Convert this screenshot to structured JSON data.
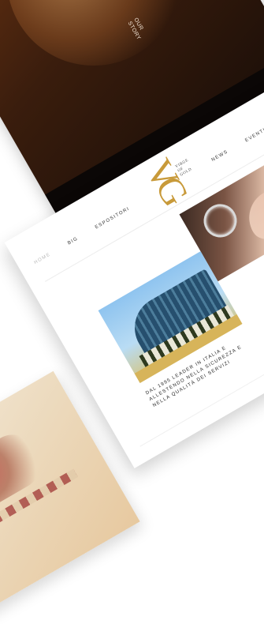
{
  "top_card": {
    "caption_lines": [
      "OUR",
      "STORY"
    ]
  },
  "site": {
    "nav_left": [
      "HOME",
      "BIG",
      "ESPOSITORI"
    ],
    "nav_right": [
      "NEWS",
      "EVENTI"
    ],
    "logo": {
      "monogram": "VG",
      "word_lines": [
        "VIRGE",
        "OF",
        "GOLD"
      ]
    },
    "intro_lines": [
      "DAL 1995 LEADER IN ITALIA E",
      "ALLESTENDO NELLA SICUREZZA E",
      "NELLA QUALITÀ DEI SERVIZI"
    ]
  },
  "colors": {
    "gold": "#c89a3a",
    "dark": "#1a0e08"
  }
}
